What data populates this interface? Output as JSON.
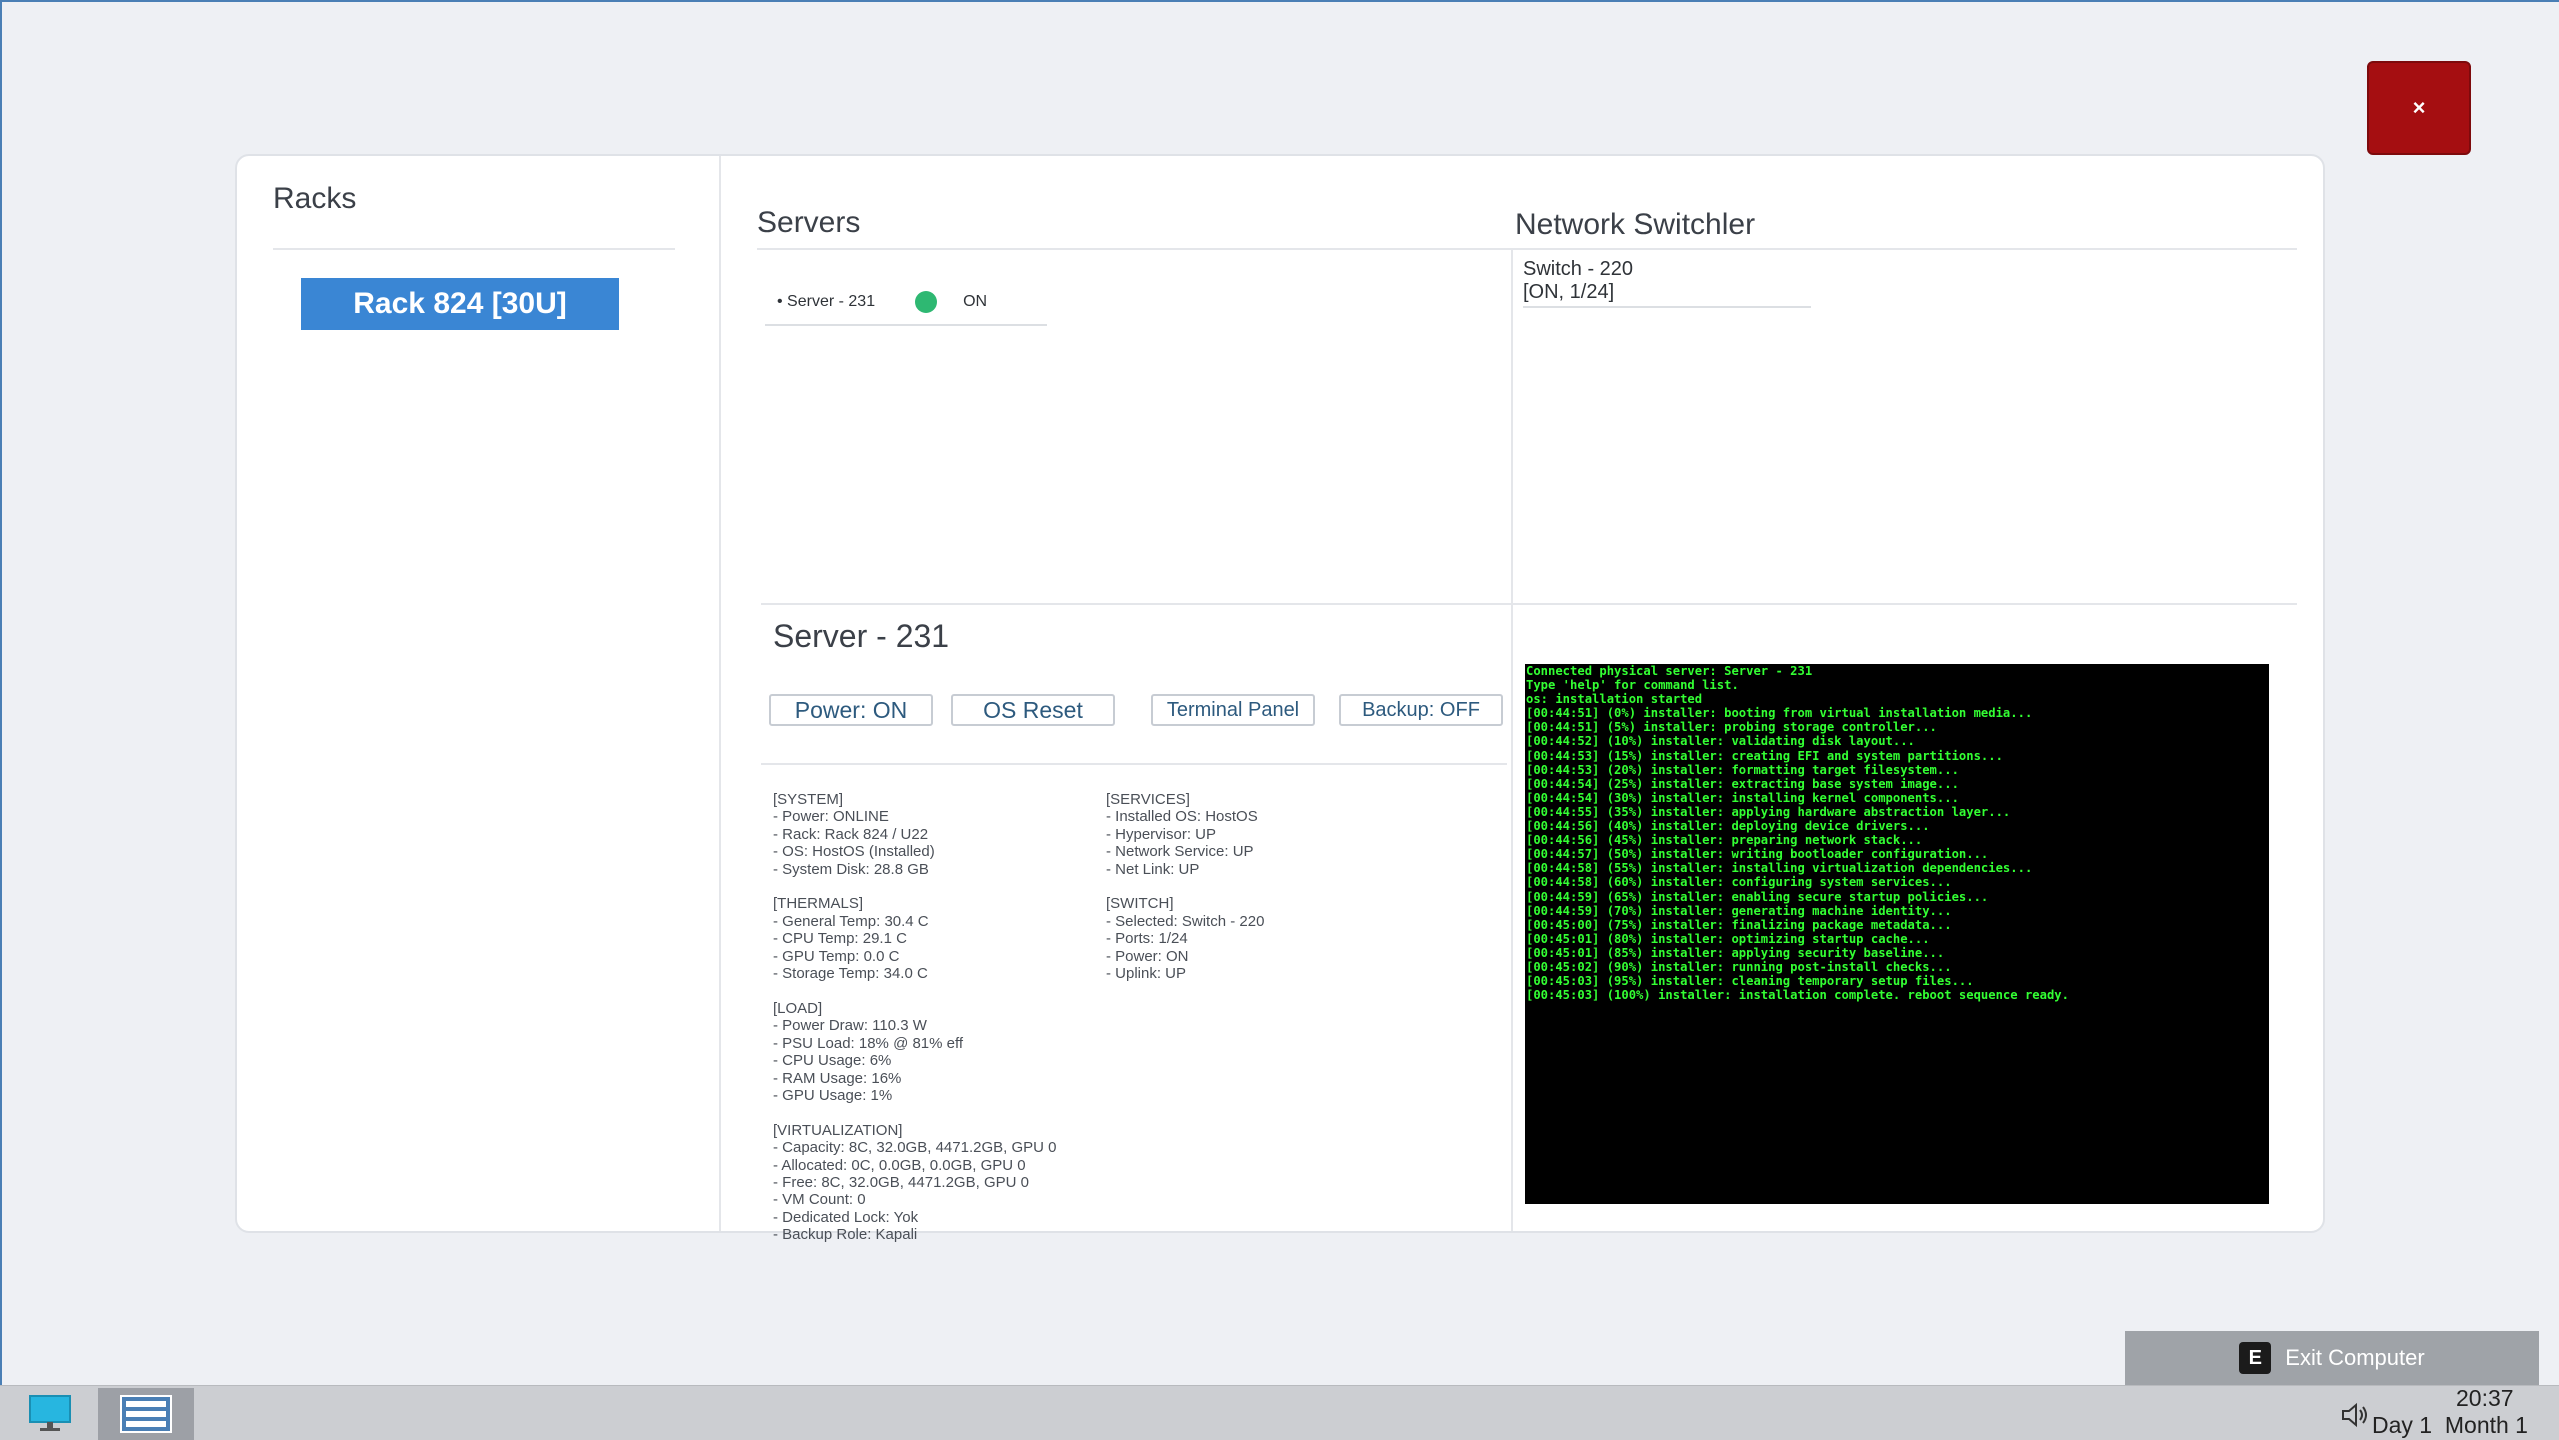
{
  "close_label": "×",
  "racks": {
    "title": "Racks",
    "items": [
      {
        "label": "Rack 824 [30U]"
      }
    ]
  },
  "servers": {
    "title": "Servers",
    "items": [
      {
        "label": "• Server - 231",
        "status": "ON",
        "status_color": "#2eb872"
      }
    ]
  },
  "network": {
    "title": "Network Switchler",
    "items": [
      {
        "line1": "Switch - 220",
        "line2": "[ON, 1/24]"
      }
    ]
  },
  "detail": {
    "title": "Server - 231",
    "buttons": {
      "power": "Power: ON",
      "os_reset": "OS Reset",
      "terminal": "Terminal Panel",
      "backup": "Backup: OFF"
    },
    "left_info": [
      "[SYSTEM]",
      "- Power: ONLINE",
      "- Rack: Rack 824 / U22",
      "- OS: HostOS (Installed)",
      "- System Disk: 28.8 GB",
      "",
      "[THERMALS]",
      "- General Temp: 30.4 C",
      "- CPU Temp: 29.1 C",
      "- GPU Temp: 0.0 C",
      "- Storage Temp: 34.0 C",
      "",
      "[LOAD]",
      "- Power Draw: 110.3 W",
      "- PSU Load: 18% @ 81% eff",
      "- CPU Usage: 6%",
      "- RAM Usage: 16%",
      "- GPU Usage: 1%",
      "",
      "[VIRTUALIZATION]",
      "- Capacity: 8C, 32.0GB, 4471.2GB, GPU 0",
      "- Allocated: 0C, 0.0GB, 0.0GB, GPU 0",
      "- Free: 8C, 32.0GB, 4471.2GB, GPU 0",
      "- VM Count: 0",
      "- Dedicated Lock: Yok",
      "- Backup Role: Kapali"
    ],
    "right_info": [
      "[SERVICES]",
      "- Installed OS: HostOS",
      "- Hypervisor: UP",
      "- Network Service: UP",
      "- Net Link: UP",
      "",
      "[SWITCH]",
      "- Selected: Switch - 220",
      "- Ports: 1/24",
      "- Power: ON",
      "- Uplink: UP"
    ]
  },
  "terminal": {
    "lines": [
      "Connected physical server: Server - 231",
      "Type 'help' for command list.",
      "os: installation started",
      "[00:44:51] (0%) installer: booting from virtual installation media...",
      "[00:44:51] (5%) installer: probing storage controller...",
      "[00:44:52] (10%) installer: validating disk layout...",
      "[00:44:53] (15%) installer: creating EFI and system partitions...",
      "[00:44:53] (20%) installer: formatting target filesystem...",
      "[00:44:54] (25%) installer: extracting base system image...",
      "[00:44:54] (30%) installer: installing kernel components...",
      "[00:44:55] (35%) installer: applying hardware abstraction layer...",
      "[00:44:56] (40%) installer: deploying device drivers...",
      "[00:44:56] (45%) installer: preparing network stack...",
      "[00:44:57] (50%) installer: writing bootloader configuration...",
      "[00:44:58] (55%) installer: installing virtualization dependencies...",
      "[00:44:58] (60%) installer: configuring system services...",
      "[00:44:59] (65%) installer: enabling secure startup policies...",
      "[00:44:59] (70%) installer: generating machine identity...",
      "[00:45:00] (75%) installer: finalizing package metadata...",
      "[00:45:01] (80%) installer: optimizing startup cache...",
      "[00:45:01] (85%) installer: applying security baseline...",
      "[00:45:02] (90%) installer: running post-install checks...",
      "[00:45:03] (95%) installer: cleaning temporary setup files...",
      "[00:45:03] (100%) installer: installation complete. reboot sequence ready."
    ]
  },
  "exit": {
    "key": "E",
    "label": "Exit Computer"
  },
  "taskbar": {
    "time": "20:37",
    "date": "Day 1  Month 1"
  }
}
